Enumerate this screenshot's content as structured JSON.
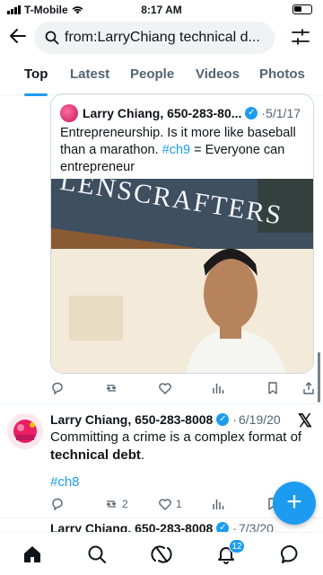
{
  "status_bar": {
    "carrier": "T-Mobile",
    "time": "8:17 AM"
  },
  "search": {
    "query": "from:LarryChiang technical d..."
  },
  "tabs": [
    {
      "label": "Top",
      "active": true
    },
    {
      "label": "Latest",
      "active": false
    },
    {
      "label": "People",
      "active": false
    },
    {
      "label": "Videos",
      "active": false
    },
    {
      "label": "Photos",
      "active": false
    }
  ],
  "quote_tweet": {
    "author": "Larry Chiang, 650-283-80...",
    "date": "5/1/17",
    "text_before": "Entrepreneurship. Is it more like baseball than a marathon. ",
    "hashtag": "#ch9",
    "text_after": " = Everyone can entrepreneur",
    "image_sign": "LENSCRAFTERS"
  },
  "tweet1_actions": {
    "reply": "",
    "retweet": "",
    "like": "",
    "views": ""
  },
  "tweet2": {
    "author": "Larry Chiang, 650-283-8008",
    "date": "6/19/20",
    "text_line": "Committing a crime is a complex format of",
    "text_bold": "technical debt",
    "text_end": ".",
    "hashtag": "#ch8",
    "retweets": "2",
    "likes": "1"
  },
  "tweet3": {
    "author": "Larry Chiang, 650-283-8008",
    "date": "7/3/20"
  },
  "bottom_nav": {
    "notifications_badge": "12"
  },
  "colors": {
    "accent": "#1d9bf0",
    "text": "#0f1419",
    "secondary": "#536471"
  },
  "icons": [
    "back-arrow-icon",
    "search-icon",
    "filter-icon",
    "verified-icon",
    "reply-icon",
    "retweet-icon",
    "like-icon",
    "views-icon",
    "bookmark-icon",
    "share-icon",
    "x-logo-icon",
    "home-icon",
    "explore-icon",
    "grok-icon",
    "bell-icon",
    "messages-icon",
    "compose-icon"
  ]
}
